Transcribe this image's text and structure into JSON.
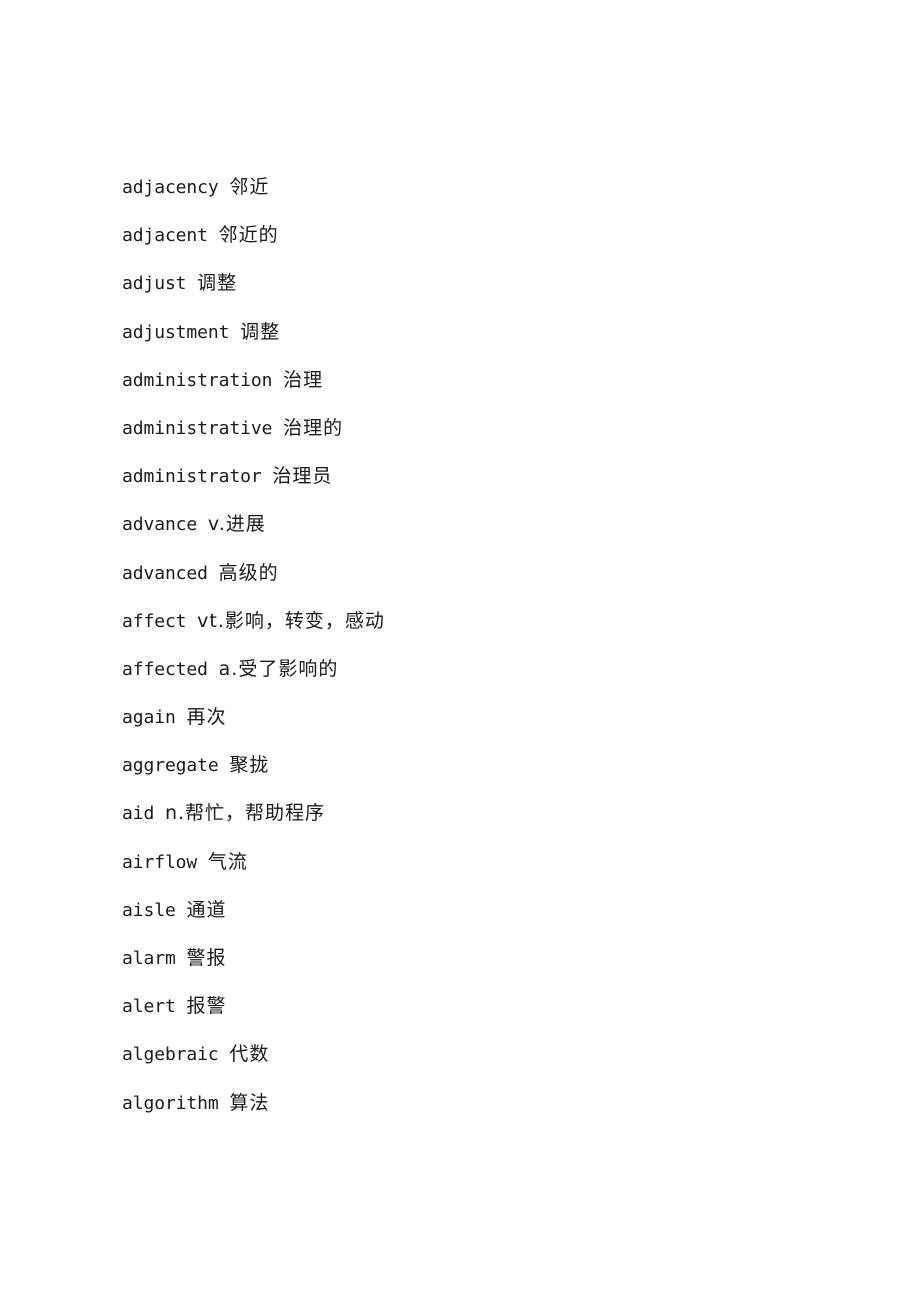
{
  "document": {
    "entries": [
      {
        "term": "adjacency",
        "definition": "邻近"
      },
      {
        "term": "adjacent",
        "definition": "邻近的"
      },
      {
        "term": "adjust",
        "definition": "调整"
      },
      {
        "term": "adjustment",
        "definition": "调整"
      },
      {
        "term": "administration",
        "definition": "治理"
      },
      {
        "term": "administrative",
        "definition": "治理的"
      },
      {
        "term": "administrator",
        "definition": "治理员"
      },
      {
        "term": "advance",
        "definition": "v.进展"
      },
      {
        "term": "advanced",
        "definition": "高级的"
      },
      {
        "term": "affect",
        "definition": "vt.影响，转变，感动"
      },
      {
        "term": "affected",
        "definition": "a.受了影响的"
      },
      {
        "term": "again",
        "definition": "再次"
      },
      {
        "term": "aggregate",
        "definition": "聚拢"
      },
      {
        "term": "aid",
        "definition": "n.帮忙，帮助程序"
      },
      {
        "term": "airflow",
        "definition": "气流"
      },
      {
        "term": "aisle",
        "definition": "通道"
      },
      {
        "term": "alarm",
        "definition": "警报"
      },
      {
        "term": "alert",
        "definition": "报警"
      },
      {
        "term": "algebraic",
        "definition": "代数"
      },
      {
        "term": "algorithm",
        "definition": "算法"
      }
    ]
  }
}
